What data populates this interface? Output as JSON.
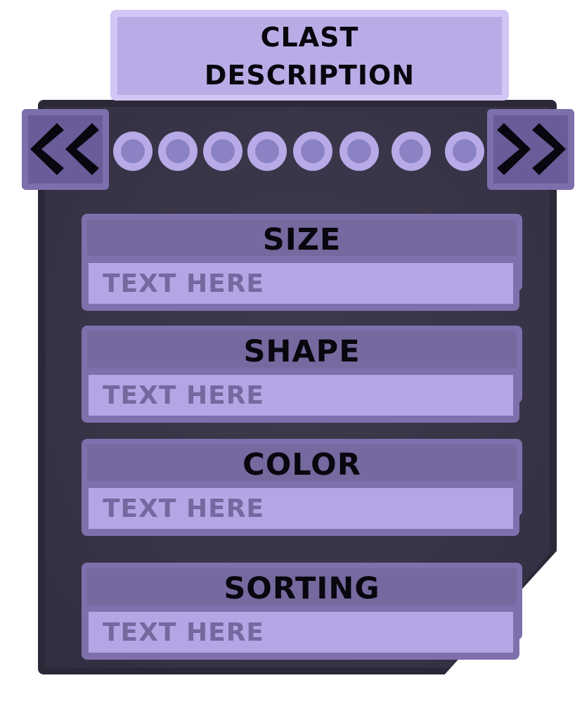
{
  "title": {
    "line1": "CLAST",
    "line2": "DESCRIPTION"
  },
  "navigation": {
    "prev_label": "<<",
    "next_label": ">>",
    "page_dots": 8
  },
  "fields": [
    {
      "label": "SIZE",
      "placeholder": "TEXT HERE"
    },
    {
      "label": "SHAPE",
      "placeholder": "TEXT HERE"
    },
    {
      "label": "COLOR",
      "placeholder": "TEXT HERE"
    },
    {
      "label": "SORTING",
      "placeholder": "TEXT HERE"
    }
  ],
  "colors": {
    "panel_dark": "#2b2838",
    "banner_light": "#b9ace6",
    "card_header": "#7f70ad",
    "field_fill": "#b4a6e5",
    "text_dark": "#08060e"
  }
}
